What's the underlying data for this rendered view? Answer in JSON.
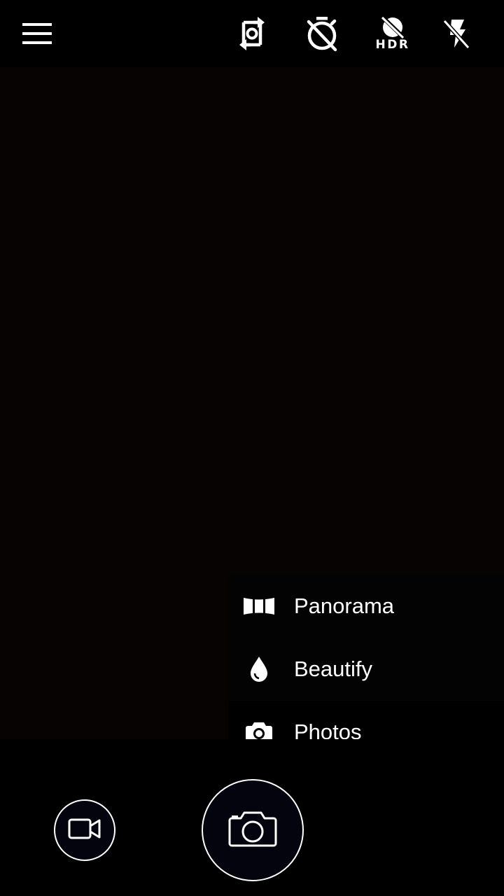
{
  "top_bar": {
    "icons": {
      "menu": "hamburger-menu-icon",
      "switch_camera": "switch-camera-icon",
      "timer": "timer-off-icon",
      "hdr": "hdr-off-icon",
      "flash": "flash-off-icon"
    },
    "hdr_label": "HDR"
  },
  "mode_menu": {
    "items": [
      {
        "label": "Panorama",
        "icon": "panorama-icon"
      },
      {
        "label": "Beautify",
        "icon": "water-drop-icon"
      },
      {
        "label": "Photos",
        "icon": "camera-icon"
      }
    ]
  },
  "bottom_bar": {
    "video_icon": "video-camera-icon",
    "shutter_icon": "camera-outline-icon"
  },
  "colors": {
    "background": "#000000",
    "viewfinder": "#070303",
    "foreground": "#ffffff",
    "button_fill": "#04040f"
  }
}
